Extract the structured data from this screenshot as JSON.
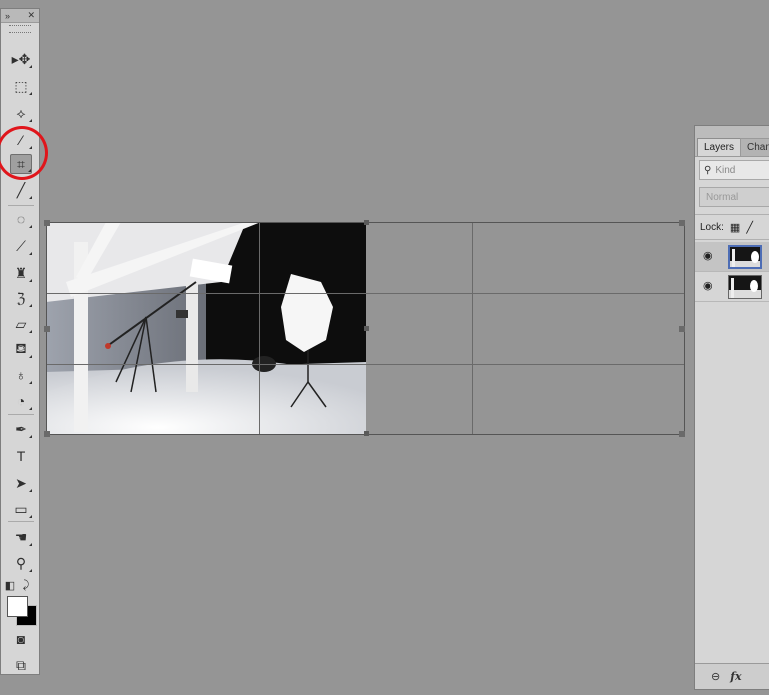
{
  "tools_panel": {
    "collapse_glyph": "»",
    "close_glyph": "✕",
    "tools": [
      {
        "name": "move-tool-icon",
        "glyph": "▸✥"
      },
      {
        "name": "rectangular-marquee-tool-icon",
        "glyph": "⬚"
      },
      {
        "name": "lasso-tool-icon",
        "glyph": "⟡"
      },
      {
        "name": "quick-selection-tool-icon",
        "glyph": "⁄"
      },
      {
        "name": "crop-tool-icon",
        "glyph": "⌗"
      },
      {
        "name": "eyedropper-tool-icon",
        "glyph": "╱"
      },
      {
        "name": "spot-healing-brush-icon",
        "glyph": "◌"
      },
      {
        "name": "brush-tool-icon",
        "glyph": "⟋"
      },
      {
        "name": "clone-stamp-tool-icon",
        "glyph": "♜"
      },
      {
        "name": "history-brush-icon",
        "glyph": "ℨ"
      },
      {
        "name": "eraser-tool-icon",
        "glyph": "▱"
      },
      {
        "name": "paint-bucket-tool-icon",
        "glyph": "⛾"
      },
      {
        "name": "blur-tool-icon",
        "glyph": "♁"
      },
      {
        "name": "dodge-tool-icon",
        "glyph": "◔"
      },
      {
        "name": "pen-tool-icon",
        "glyph": "✒"
      },
      {
        "name": "type-tool-icon",
        "glyph": "T"
      },
      {
        "name": "path-selection-tool-icon",
        "glyph": "➤"
      },
      {
        "name": "rectangle-shape-tool-icon",
        "glyph": "▭"
      },
      {
        "name": "hand-tool-icon",
        "glyph": "☚"
      },
      {
        "name": "zoom-tool-icon",
        "glyph": "⚲"
      },
      {
        "name": "default-colors-icon",
        "glyph": "◧"
      },
      {
        "name": "swap-colors-icon",
        "glyph": "⤸"
      },
      {
        "name": "quick-mask-icon",
        "glyph": "◙"
      },
      {
        "name": "screen-mode-icon",
        "glyph": "⧉"
      }
    ],
    "foreground_color": "#ffffff",
    "background_color": "#000000",
    "highlight_color": "#e0151b"
  },
  "layers_panel": {
    "tabs": [
      "Layers",
      "Chan"
    ],
    "kind_placeholder": "Kind",
    "blend_mode": "Normal",
    "lock_label": "Lock:",
    "layers": [
      {
        "selected": true
      },
      {
        "selected": false
      }
    ],
    "footer": {
      "link_glyph": "⊖",
      "fx_label": "fx"
    }
  },
  "colors": {
    "workspace": "#959595",
    "panel": "#d6d6d6",
    "selection": "#4d6db5"
  }
}
